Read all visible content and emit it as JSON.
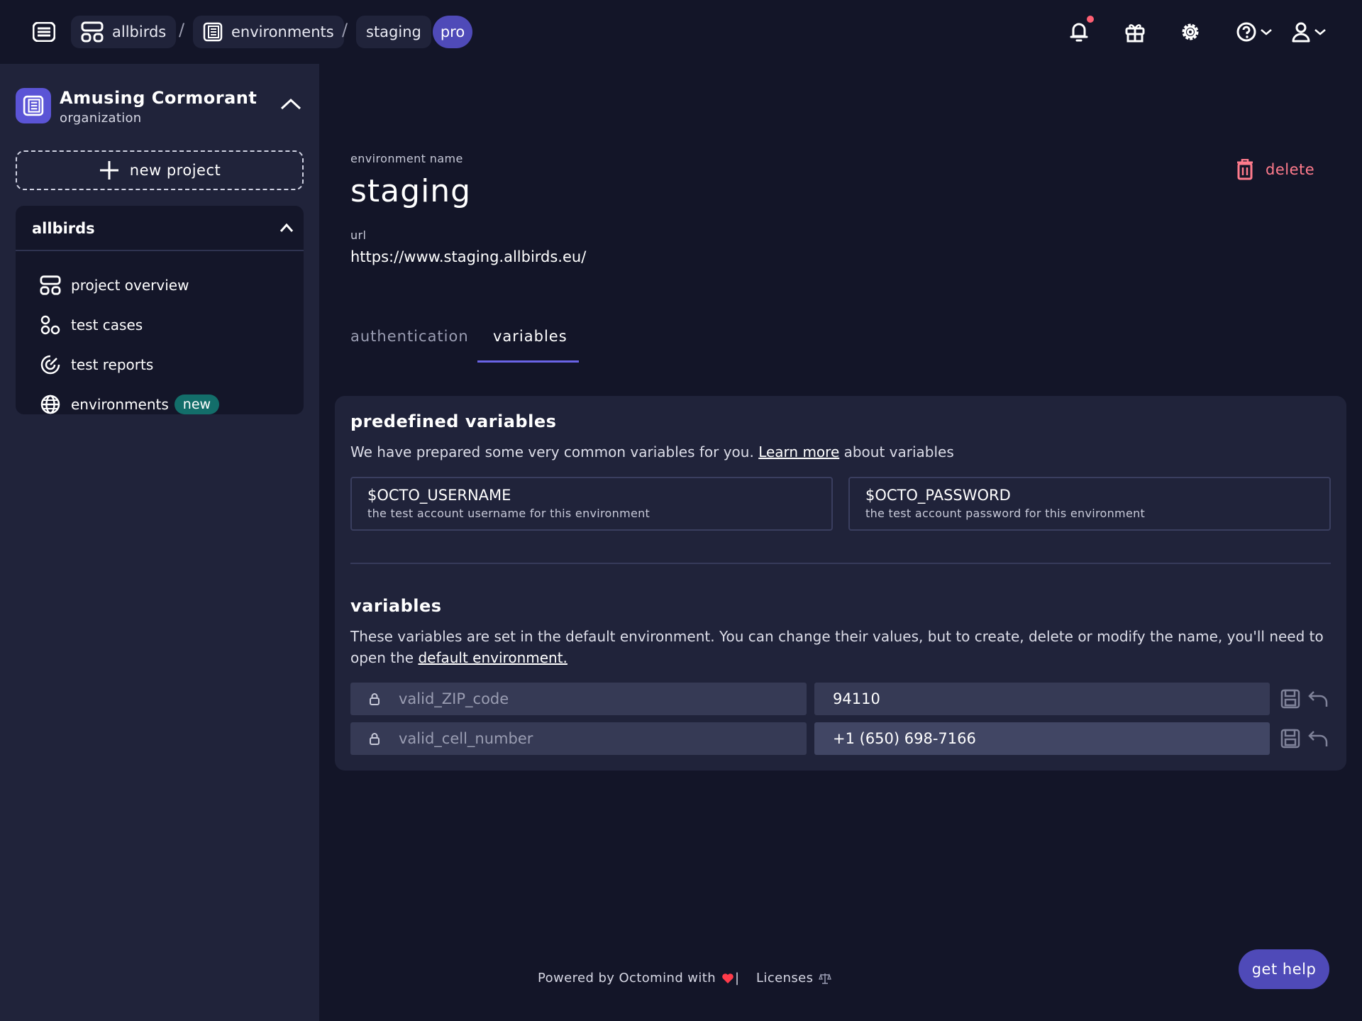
{
  "breadcrumb": {
    "project": "allbirds",
    "section": "environments",
    "environment": "staging",
    "separator": "/",
    "plan_badge": "pro"
  },
  "header_icons": [
    "menu-icon",
    "bell-icon",
    "gift-icon",
    "gear-icon",
    "help-icon",
    "user-icon"
  ],
  "sidebar": {
    "org_name": "Amusing Cormorant",
    "org_type": "organization",
    "new_project_label": "new project",
    "project_name": "allbirds",
    "nav": [
      {
        "label": "project overview",
        "icon": "layout-icon"
      },
      {
        "label": "test cases",
        "icon": "test-cases-icon"
      },
      {
        "label": "test reports",
        "icon": "reports-icon"
      },
      {
        "label": "environments",
        "icon": "globe-icon",
        "badge": "new"
      }
    ]
  },
  "environment": {
    "name_label": "environment name",
    "name": "staging",
    "url_label": "url",
    "url": "https://www.staging.allbirds.eu/",
    "delete_label": "delete"
  },
  "tabs": [
    {
      "label": "authentication",
      "active": false
    },
    {
      "label": "variables",
      "active": true
    }
  ],
  "predefined": {
    "title": "predefined variables",
    "desc_before": "We have prepared some very common variables for you.",
    "desc_link": "Learn more",
    "desc_after": "about variables",
    "items": [
      {
        "name": "$OCTO_USERNAME",
        "desc": "the test account username for this environment"
      },
      {
        "name": "$OCTO_PASSWORD",
        "desc": "the test account password for this environment"
      }
    ]
  },
  "variables": {
    "title": "variables",
    "desc_before": "These variables are set in the default environment. You can change their values, but to create, delete or modify the name, you'll need to open the",
    "desc_link": "default environment.",
    "rows": [
      {
        "name": "valid_ZIP_code",
        "value": "94110"
      },
      {
        "name": "valid_cell_number",
        "value": "+1 (650) 698-7166"
      }
    ]
  },
  "footer": {
    "powered_by": "Powered by Octomind with",
    "separator": "|",
    "licenses": "Licenses"
  },
  "get_help_label": "get help",
  "colors": {
    "background": "#131528",
    "sidebar": "#20233a",
    "accent": "#4f4ab8",
    "danger": "#ff7b8c",
    "badge_new": "#136e6a"
  }
}
